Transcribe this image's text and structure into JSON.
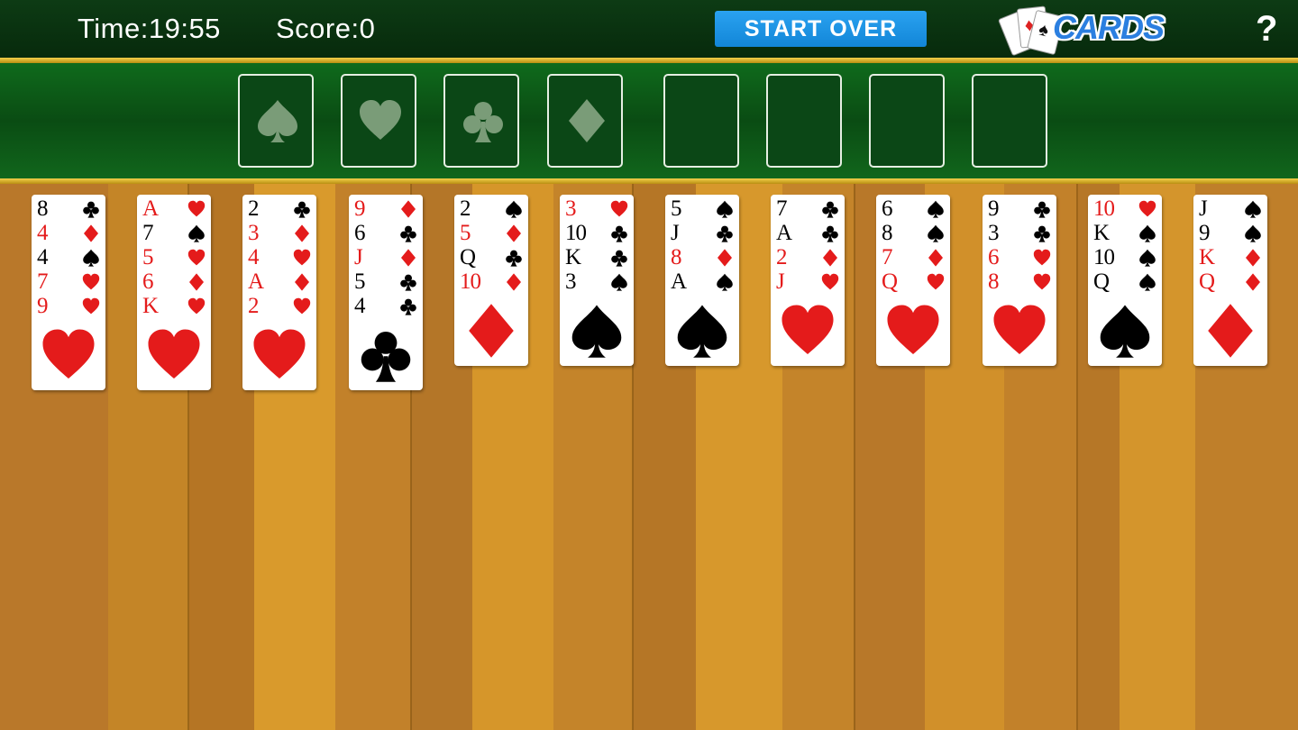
{
  "header": {
    "time_label": "Time:19:55",
    "score_label": "Score:0",
    "start_over_label": "START OVER",
    "logo_text": "CARDS",
    "help_label": "?"
  },
  "colors": {
    "topbar": "#072a0c",
    "felt": "#0b4716",
    "gold": "#f2cf4a",
    "wood_dark": "#b9782a",
    "wood_light": "#d99a2c",
    "red_suit": "#e41b1b",
    "button": "#1a90e0"
  },
  "foundations": [
    {
      "suit": "spade"
    },
    {
      "suit": "heart"
    },
    {
      "suit": "club"
    },
    {
      "suit": "diamond"
    },
    {
      "suit": ""
    },
    {
      "suit": ""
    },
    {
      "suit": ""
    },
    {
      "suit": ""
    }
  ],
  "tableau": [
    [
      {
        "rank": "8",
        "suit": "club"
      },
      {
        "rank": "4",
        "suit": "diamond"
      },
      {
        "rank": "4",
        "suit": "spade"
      },
      {
        "rank": "7",
        "suit": "heart"
      },
      {
        "rank": "9",
        "suit": "heart"
      }
    ],
    [
      {
        "rank": "A",
        "suit": "heart"
      },
      {
        "rank": "7",
        "suit": "spade"
      },
      {
        "rank": "5",
        "suit": "heart"
      },
      {
        "rank": "6",
        "suit": "diamond"
      },
      {
        "rank": "K",
        "suit": "heart"
      }
    ],
    [
      {
        "rank": "2",
        "suit": "club"
      },
      {
        "rank": "3",
        "suit": "diamond"
      },
      {
        "rank": "4",
        "suit": "heart"
      },
      {
        "rank": "A",
        "suit": "diamond"
      },
      {
        "rank": "2",
        "suit": "heart"
      }
    ],
    [
      {
        "rank": "9",
        "suit": "diamond"
      },
      {
        "rank": "6",
        "suit": "club"
      },
      {
        "rank": "J",
        "suit": "diamond"
      },
      {
        "rank": "5",
        "suit": "club"
      },
      {
        "rank": "4",
        "suit": "club"
      }
    ],
    [
      {
        "rank": "2",
        "suit": "spade"
      },
      {
        "rank": "5",
        "suit": "diamond"
      },
      {
        "rank": "Q",
        "suit": "club"
      },
      {
        "rank": "10",
        "suit": "diamond"
      }
    ],
    [
      {
        "rank": "3",
        "suit": "heart"
      },
      {
        "rank": "10",
        "suit": "club"
      },
      {
        "rank": "K",
        "suit": "club"
      },
      {
        "rank": "3",
        "suit": "spade"
      }
    ],
    [
      {
        "rank": "5",
        "suit": "spade"
      },
      {
        "rank": "J",
        "suit": "club"
      },
      {
        "rank": "8",
        "suit": "diamond"
      },
      {
        "rank": "A",
        "suit": "spade"
      }
    ],
    [
      {
        "rank": "7",
        "suit": "club"
      },
      {
        "rank": "A",
        "suit": "club"
      },
      {
        "rank": "2",
        "suit": "diamond"
      },
      {
        "rank": "J",
        "suit": "heart"
      }
    ],
    [
      {
        "rank": "6",
        "suit": "spade"
      },
      {
        "rank": "8",
        "suit": "spade"
      },
      {
        "rank": "7",
        "suit": "diamond"
      },
      {
        "rank": "Q",
        "suit": "heart"
      }
    ],
    [
      {
        "rank": "9",
        "suit": "club"
      },
      {
        "rank": "3",
        "suit": "club"
      },
      {
        "rank": "6",
        "suit": "heart"
      },
      {
        "rank": "8",
        "suit": "heart"
      }
    ],
    [
      {
        "rank": "10",
        "suit": "heart"
      },
      {
        "rank": "K",
        "suit": "spade"
      },
      {
        "rank": "10",
        "suit": "spade"
      },
      {
        "rank": "Q",
        "suit": "spade"
      }
    ],
    [
      {
        "rank": "J",
        "suit": "spade"
      },
      {
        "rank": "9",
        "suit": "spade"
      },
      {
        "rank": "K",
        "suit": "diamond"
      },
      {
        "rank": "Q",
        "suit": "diamond"
      }
    ]
  ]
}
